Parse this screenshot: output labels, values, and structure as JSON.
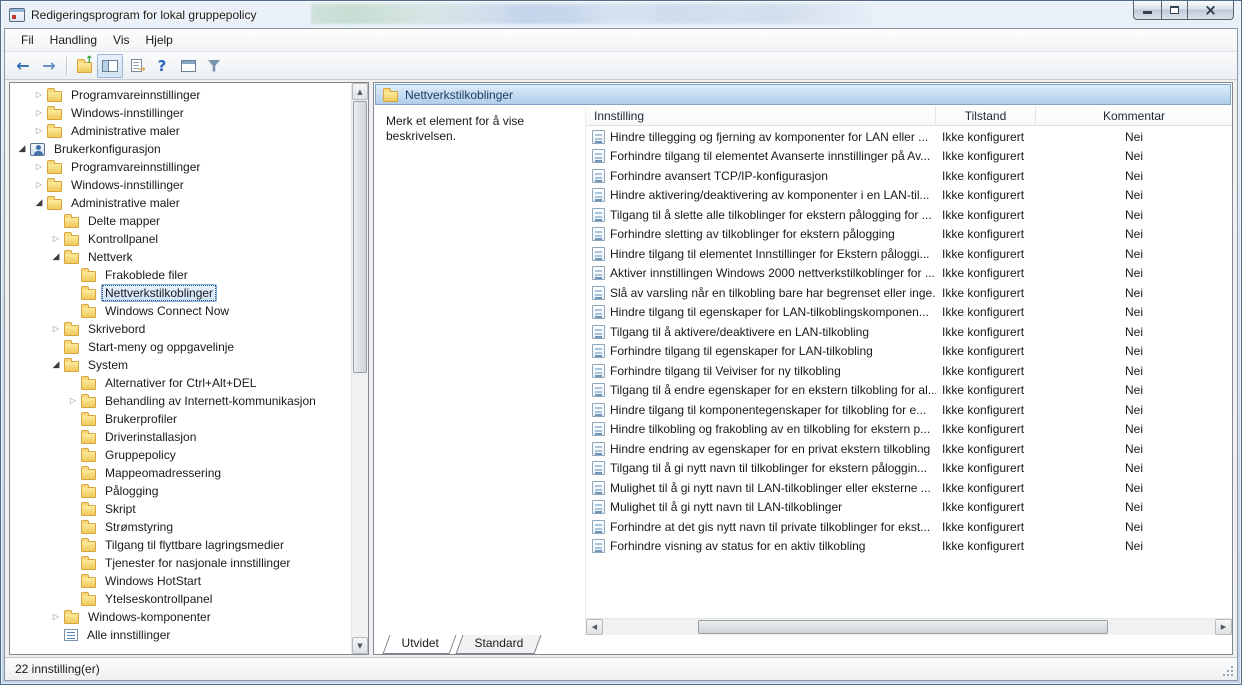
{
  "window": {
    "title": "Redigeringsprogram for lokal gruppepolicy",
    "app_icon": "mmc-console-icon",
    "caption_buttons": [
      {
        "name": "minimize",
        "icon": "minimize"
      },
      {
        "name": "maximize",
        "icon": "maximize"
      },
      {
        "name": "close",
        "icon": "close"
      }
    ]
  },
  "menu": {
    "items": [
      "Fil",
      "Handling",
      "Vis",
      "Hjelp"
    ]
  },
  "toolbar": {
    "buttons": [
      {
        "name": "back",
        "icon": "back-arrow"
      },
      {
        "name": "forward",
        "icon": "forward-arrow"
      },
      {
        "separator": true
      },
      {
        "name": "up-one-level",
        "icon": "folder-up"
      },
      {
        "name": "show-console-tree",
        "icon": "panes",
        "checked": true
      },
      {
        "name": "export-list",
        "icon": "export-doc"
      },
      {
        "name": "help",
        "icon": "help"
      },
      {
        "name": "properties",
        "icon": "window"
      },
      {
        "name": "filter",
        "icon": "funnel"
      }
    ]
  },
  "tree": {
    "items": [
      {
        "label": "Programvareinnstillinger",
        "level": 1,
        "arrow": "collapsed",
        "icon": "folder"
      },
      {
        "label": "Windows-innstillinger",
        "level": 1,
        "arrow": "collapsed",
        "icon": "folder"
      },
      {
        "label": "Administrative maler",
        "level": 1,
        "arrow": "collapsed",
        "icon": "folder"
      },
      {
        "label": "Brukerkonfigurasjon",
        "level": 0,
        "arrow": "expanded",
        "icon": "user"
      },
      {
        "label": "Programvareinnstillinger",
        "level": 1,
        "arrow": "collapsed",
        "icon": "folder"
      },
      {
        "label": "Windows-innstillinger",
        "level": 1,
        "arrow": "collapsed",
        "icon": "folder"
      },
      {
        "label": "Administrative maler",
        "level": 1,
        "arrow": "expanded",
        "icon": "folder"
      },
      {
        "label": "Delte mapper",
        "level": 2,
        "arrow": "none",
        "icon": "folder"
      },
      {
        "label": "Kontrollpanel",
        "level": 2,
        "arrow": "collapsed",
        "icon": "folder"
      },
      {
        "label": "Nettverk",
        "level": 2,
        "arrow": "expanded",
        "icon": "folder"
      },
      {
        "label": "Frakoblede filer",
        "level": 3,
        "arrow": "none",
        "icon": "folder"
      },
      {
        "label": "Nettverkstilkoblinger",
        "level": 3,
        "arrow": "none",
        "icon": "folder",
        "selected": true
      },
      {
        "label": "Windows Connect Now",
        "level": 3,
        "arrow": "none",
        "icon": "folder"
      },
      {
        "label": "Skrivebord",
        "level": 2,
        "arrow": "collapsed",
        "icon": "folder"
      },
      {
        "label": "Start-meny og oppgavelinje",
        "level": 2,
        "arrow": "none",
        "icon": "folder"
      },
      {
        "label": "System",
        "level": 2,
        "arrow": "expanded",
        "icon": "folder"
      },
      {
        "label": "Alternativer for Ctrl+Alt+DEL",
        "level": 3,
        "arrow": "none",
        "icon": "folder"
      },
      {
        "label": "Behandling av Internett-kommunikasjon",
        "level": 3,
        "arrow": "collapsed",
        "icon": "folder"
      },
      {
        "label": "Brukerprofiler",
        "level": 3,
        "arrow": "none",
        "icon": "folder"
      },
      {
        "label": "Driverinstallasjon",
        "level": 3,
        "arrow": "none",
        "icon": "folder"
      },
      {
        "label": "Gruppepolicy",
        "level": 3,
        "arrow": "none",
        "icon": "folder"
      },
      {
        "label": "Mappeomadressering",
        "level": 3,
        "arrow": "none",
        "icon": "folder"
      },
      {
        "label": "Pålogging",
        "level": 3,
        "arrow": "none",
        "icon": "folder"
      },
      {
        "label": "Skript",
        "level": 3,
        "arrow": "none",
        "icon": "folder"
      },
      {
        "label": "Strømstyring",
        "level": 3,
        "arrow": "none",
        "icon": "folder"
      },
      {
        "label": "Tilgang til flyttbare lagringsmedier",
        "level": 3,
        "arrow": "none",
        "icon": "folder"
      },
      {
        "label": "Tjenester for nasjonale innstillinger",
        "level": 3,
        "arrow": "none",
        "icon": "folder"
      },
      {
        "label": "Windows HotStart",
        "level": 3,
        "arrow": "none",
        "icon": "folder"
      },
      {
        "label": "Ytelseskontrollpanel",
        "level": 3,
        "arrow": "none",
        "icon": "folder"
      },
      {
        "label": "Windows-komponenter",
        "level": 2,
        "arrow": "collapsed",
        "icon": "folder"
      },
      {
        "label": "Alle innstillinger",
        "level": 2,
        "arrow": "none",
        "icon": "settings"
      }
    ]
  },
  "content_pane": {
    "title": "Nettverkstilkoblinger",
    "title_icon": "folder",
    "description": "Merk et element for å vise beskrivelsen."
  },
  "list": {
    "columns": [
      "Innstilling",
      "Tilstand",
      "Kommentar"
    ],
    "rows": [
      {
        "name": "Hindre tillegging og fjerning av komponenter for LAN eller ...",
        "state": "Ikke konfigurert",
        "comment": "Nei"
      },
      {
        "name": "Forhindre tilgang til elementet Avanserte innstillinger på Av...",
        "state": "Ikke konfigurert",
        "comment": "Nei"
      },
      {
        "name": "Forhindre avansert TCP/IP-konfigurasjon",
        "state": "Ikke konfigurert",
        "comment": "Nei"
      },
      {
        "name": "Hindre aktivering/deaktivering av komponenter i en LAN-til...",
        "state": "Ikke konfigurert",
        "comment": "Nei"
      },
      {
        "name": "Tilgang til å slette alle tilkoblinger for ekstern pålogging for ...",
        "state": "Ikke konfigurert",
        "comment": "Nei"
      },
      {
        "name": "Forhindre sletting av tilkoblinger for ekstern pålogging",
        "state": "Ikke konfigurert",
        "comment": "Nei"
      },
      {
        "name": "Hindre tilgang til elementet Innstillinger for Ekstern påloggi...",
        "state": "Ikke konfigurert",
        "comment": "Nei"
      },
      {
        "name": "Aktiver innstillingen Windows 2000 nettverkstilkoblinger for ...",
        "state": "Ikke konfigurert",
        "comment": "Nei"
      },
      {
        "name": "Slå av varsling når en tilkobling bare har begrenset eller inge...",
        "state": "Ikke konfigurert",
        "comment": "Nei"
      },
      {
        "name": "Hindre tilgang til egenskaper for LAN-tilkoblingskomponen...",
        "state": "Ikke konfigurert",
        "comment": "Nei"
      },
      {
        "name": "Tilgang til å aktivere/deaktivere en LAN-tilkobling",
        "state": "Ikke konfigurert",
        "comment": "Nei"
      },
      {
        "name": "Forhindre tilgang til egenskaper for LAN-tilkobling",
        "state": "Ikke konfigurert",
        "comment": "Nei"
      },
      {
        "name": "Forhindre tilgang til Veiviser for ny tilkobling",
        "state": "Ikke konfigurert",
        "comment": "Nei"
      },
      {
        "name": "Tilgang til å endre egenskaper for en ekstern tilkobling for al...",
        "state": "Ikke konfigurert",
        "comment": "Nei"
      },
      {
        "name": "Hindre tilgang til komponentegenskaper for tilkobling for e...",
        "state": "Ikke konfigurert",
        "comment": "Nei"
      },
      {
        "name": "Hindre tilkobling og frakobling av en tilkobling for ekstern p...",
        "state": "Ikke konfigurert",
        "comment": "Nei"
      },
      {
        "name": "Hindre endring av egenskaper for en privat ekstern tilkobling",
        "state": "Ikke konfigurert",
        "comment": "Nei"
      },
      {
        "name": "Tilgang til å gi nytt navn til tilkoblinger for ekstern påloggin...",
        "state": "Ikke konfigurert",
        "comment": "Nei"
      },
      {
        "name": "Mulighet til å gi nytt navn til LAN-tilkoblinger eller eksterne ...",
        "state": "Ikke konfigurert",
        "comment": "Nei"
      },
      {
        "name": "Mulighet til å gi nytt navn til LAN-tilkoblinger",
        "state": "Ikke konfigurert",
        "comment": "Nei"
      },
      {
        "name": "Forhindre at det gis nytt navn til private tilkoblinger for ekst...",
        "state": "Ikke konfigurert",
        "comment": "Nei"
      },
      {
        "name": "Forhindre visning av status for en aktiv tilkobling",
        "state": "Ikke konfigurert",
        "comment": "Nei"
      }
    ]
  },
  "tabs": [
    {
      "label": "Utvidet",
      "active": true
    },
    {
      "label": "Standard",
      "active": false
    }
  ],
  "status": {
    "text": "22 innstilling(er)"
  },
  "colors": {
    "header_bar": "#b0cde9",
    "selection_fill": "#cde3f7",
    "selection_border": "#84aed6",
    "folder": "#f0c95c"
  }
}
